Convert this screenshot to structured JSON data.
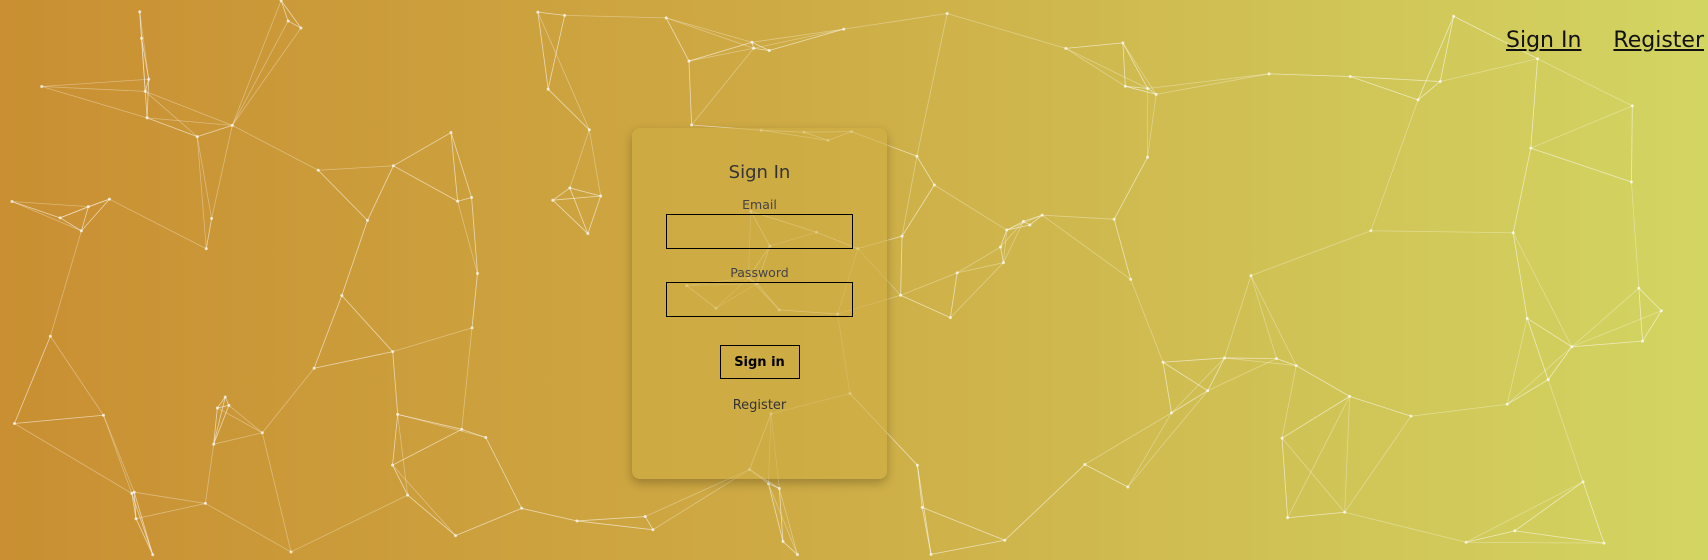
{
  "nav": {
    "sign_in": "Sign In",
    "register": "Register"
  },
  "form": {
    "title": "Sign In",
    "email_label": "Email",
    "email_value": "",
    "password_label": "Password",
    "password_value": "",
    "submit_label": "Sign in",
    "register_link": "Register"
  }
}
